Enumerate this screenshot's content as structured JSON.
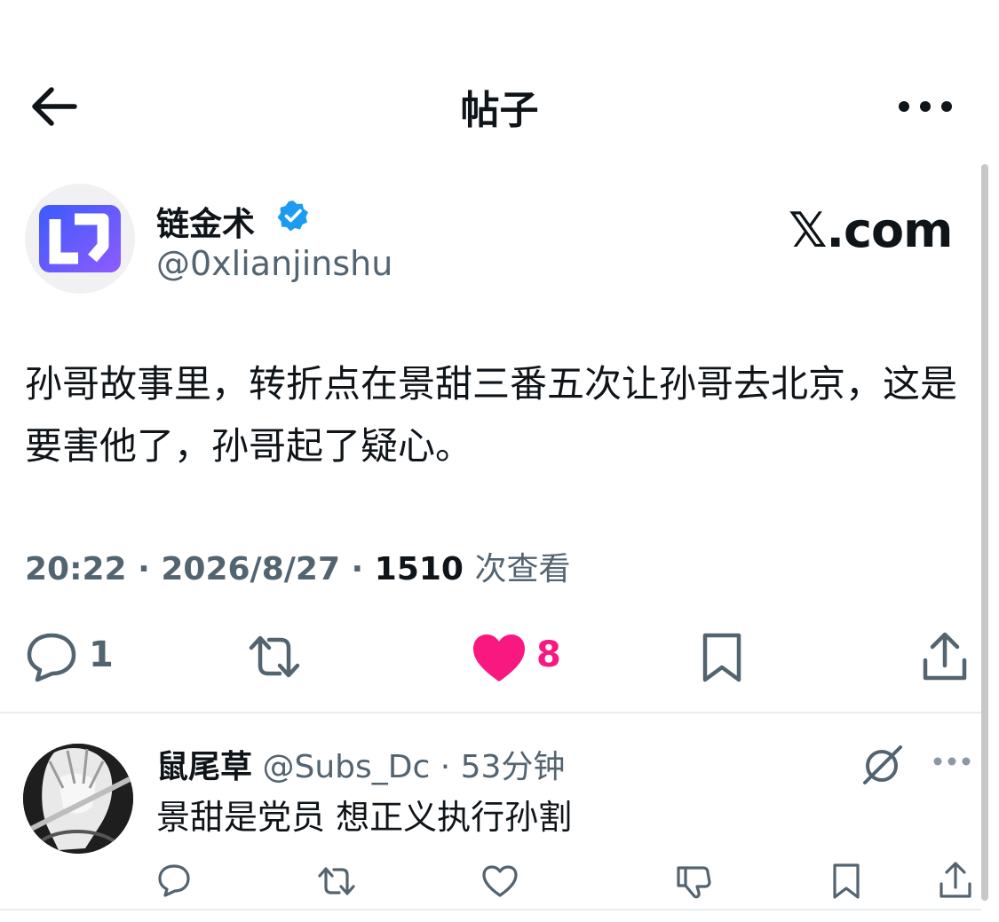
{
  "header": {
    "title": "帖子"
  },
  "post": {
    "author_name": "链金术",
    "author_handle": "@0xlianjinshu",
    "source_label": "𝕏.com",
    "text": "孙哥故事里，转折点在景甜三番五次让孙哥去北京，这是要害他了，孙哥起了疑心。",
    "time": "20:22",
    "date": "2026/8/27",
    "views_count": "1510",
    "views_label": "次查看",
    "reply_count": "1",
    "like_count": "8"
  },
  "reply": {
    "name": "鼠尾草",
    "handle": "@Subs_Dc",
    "time_ago": "53分钟",
    "text": "景甜是党员 想正义执行孙割"
  },
  "colors": {
    "like": "#f91880",
    "verified": "#1d9bf0",
    "muted": "#536471",
    "logo_blue": "#3b5bfd",
    "logo_purple": "#8f5bff"
  }
}
